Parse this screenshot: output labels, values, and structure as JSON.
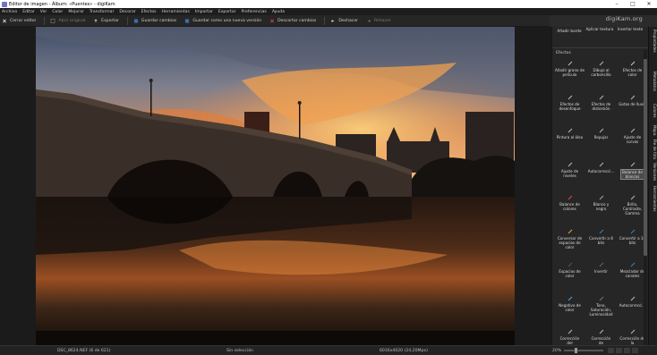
{
  "window": {
    "title": "Editor de imagen - Álbum: «Puentes» - digiKam"
  },
  "menu": [
    "Archivo",
    "Editar",
    "Ver",
    "Color",
    "Mejorar",
    "Transformar",
    "Decorar",
    "Efectos",
    "Herramientas",
    "Importar",
    "Exportar",
    "Preferencias",
    "Ayuda"
  ],
  "brand": "digiKam.org",
  "toolbar": {
    "close_editor": "Cerrar editor",
    "open_original": "Abrir original",
    "export": "Exportar",
    "save_changes": "Guardar cambios",
    "save_as_new_version": "Guardar como una nueva versión",
    "discard_changes": "Descartar cambios",
    "undo": "Deshacer",
    "redo": "Rehacer"
  },
  "sidebar": {
    "top_items": [
      "Añadir borde",
      "Aplicar textura",
      "Insertar texto"
    ],
    "section_title": "Efectos",
    "tools": [
      {
        "label": "Añadir grano de\npelícula",
        "icon": "film-grain-icon",
        "color": "#bbbbbb"
      },
      {
        "label": "Dibujo al\ncarboncillo",
        "icon": "charcoal-icon",
        "color": "#bbbbbb"
      },
      {
        "label": "Efectos de\ncolor",
        "icon": "color-effects-icon",
        "color": "#cccccc"
      },
      {
        "label": "Efectos de\ndesenfoque",
        "icon": "blur-icon",
        "color": "#bbbbbb"
      },
      {
        "label": "Efectos de\ndistorsión",
        "icon": "distortion-icon",
        "color": "#bbbbbb"
      },
      {
        "label": "Gotas de lluvia",
        "icon": "raindrops-icon",
        "color": "#bbbbbb"
      },
      {
        "label": "Pintura al óleo",
        "icon": "oil-paint-icon",
        "color": "#bbbbbb"
      },
      {
        "label": "Repujar",
        "icon": "emboss-icon",
        "color": "#bbbbbb"
      },
      {
        "label": "Ajuste de\ncurvas",
        "icon": "curves-icon",
        "color": "#bbbbbb"
      },
      {
        "label": "Ajuste de\nniveles",
        "icon": "levels-icon",
        "color": "#bbbbbb"
      },
      {
        "label": "Autocorrecci...",
        "icon": "auto-correction-icon",
        "color": "#bbbbbb"
      },
      {
        "label": "Balance de\nblancos",
        "icon": "white-balance-icon",
        "color": "#bbbbbb",
        "selected": true
      },
      {
        "label": "Balance de\ncolores",
        "icon": "color-balance-icon",
        "color": "#e04a4a"
      },
      {
        "label": "Blanco y\nnegro",
        "icon": "black-white-icon",
        "color": "#aaaaaa"
      },
      {
        "label": "Brillo,\nContraste,\nGamma",
        "icon": "brightness-contrast-icon",
        "color": "#bbbbbb"
      },
      {
        "label": "Conversor de\nespacios de\ncolor",
        "icon": "color-space-icon",
        "color": "#e6a43a"
      },
      {
        "label": "Convertir a 8\nbits",
        "icon": "convert-8bit-icon",
        "color": "#3a7fd8"
      },
      {
        "label": "Convertir a 16\nbits",
        "icon": "convert-16bit-icon",
        "color": "#3a7fd8"
      },
      {
        "label": "Espacios de\ncolor",
        "icon": "color-profiles-icon",
        "color": "#555555"
      },
      {
        "label": "Invertir",
        "icon": "invert-icon",
        "color": "#666666"
      },
      {
        "label": "Mezclador de\ncanales",
        "icon": "channel-mixer-icon",
        "color": "#3a7fd8"
      },
      {
        "label": "Negativo de\ncolor",
        "icon": "color-negative-icon",
        "color": "#4aa8e8"
      },
      {
        "label": "Tono,\nSaturación,\nLuminosidad",
        "icon": "hue-saturation-icon",
        "color": "#777777"
      },
      {
        "label": "Autocorrecci...",
        "icon": "auto-correction-2-icon",
        "color": "#bbbbbb"
      },
      {
        "label": "Corrección\ndel",
        "icon": "correction-icon",
        "color": "#bbbbbb"
      },
      {
        "label": "Corrección\nde",
        "icon": "correction-2-icon",
        "color": "#bbbbbb"
      },
      {
        "label": "Corrección de\nla",
        "icon": "correction-3-icon",
        "color": "#bbbbbb"
      }
    ]
  },
  "side_tabs": [
    "Propiedades",
    "Metadatos",
    "Colores",
    "Mapa",
    "Pie de foto",
    "Versiones",
    "Herramientas"
  ],
  "status": {
    "filename": "DSC_8624.NEF (6 de 621)",
    "selection": "Sin selección",
    "dimensions": "6016x4020 (24,20Mpx)",
    "zoom": "20%"
  }
}
